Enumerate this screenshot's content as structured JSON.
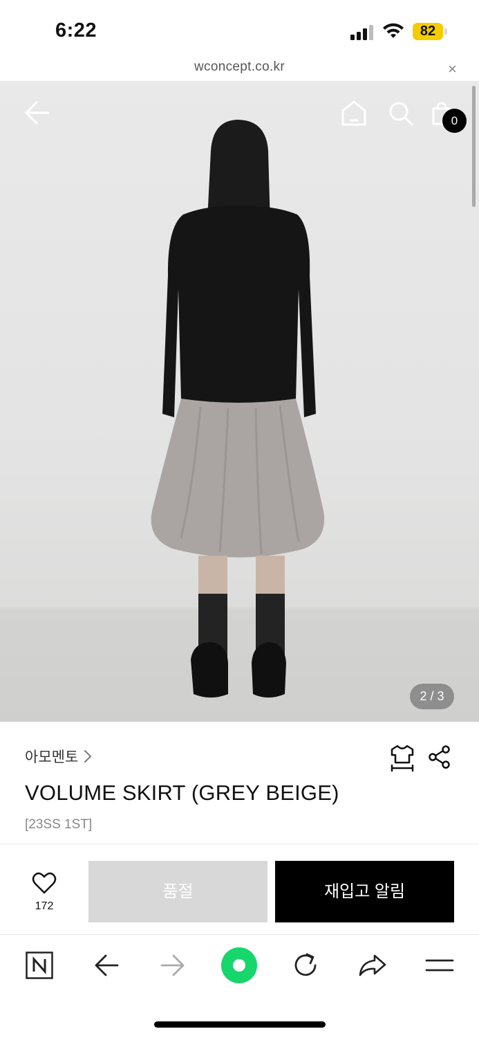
{
  "status_bar": {
    "time": "6:22",
    "battery": "82",
    "battery_color": "#f5cc00"
  },
  "url_bar": {
    "url": "wconcept.co.kr",
    "close_label": "×"
  },
  "hero": {
    "cart_count": "0",
    "image_counter": "2 / 3",
    "icons": [
      "back-arrow-icon",
      "home-icon",
      "search-icon",
      "shopping-bag-icon"
    ]
  },
  "product": {
    "brand": "아모멘토",
    "title": "VOLUME SKIRT (GREY BEIGE)",
    "subtitle": "[23SS 1ST]"
  },
  "actions": {
    "like_count": "172",
    "soldout_label": "품절",
    "restock_label": "재입고 알림"
  },
  "browser_toolbar": {
    "naver_label": "N",
    "items": [
      "naver-icon",
      "back-icon",
      "forward-icon",
      "green-dot-icon",
      "reload-icon",
      "share-icon",
      "menu-icon"
    ],
    "accent_color": "#17d66b"
  }
}
